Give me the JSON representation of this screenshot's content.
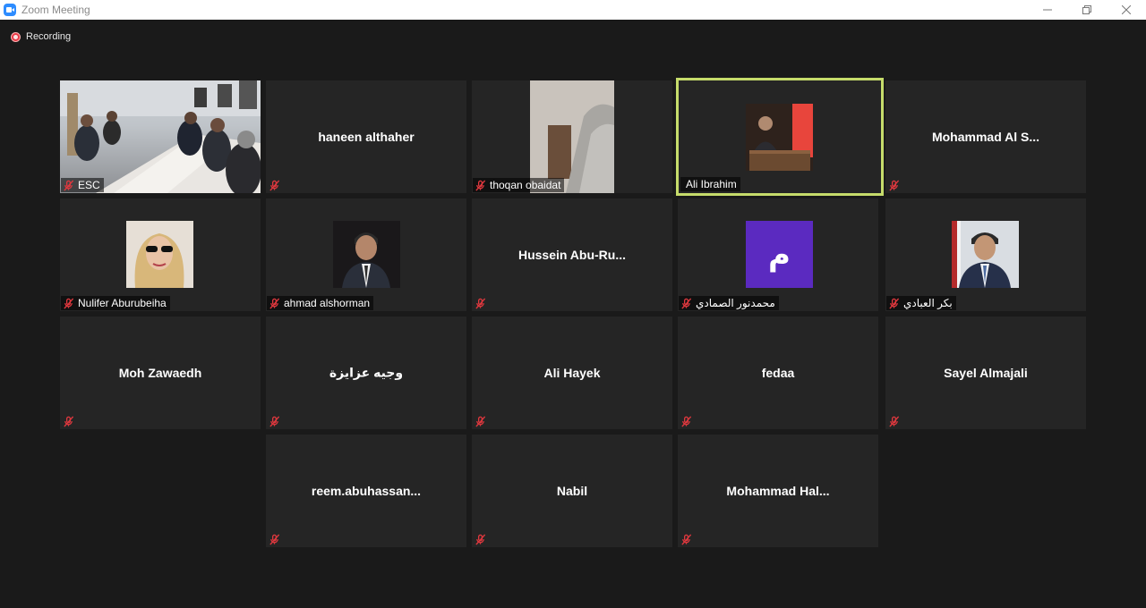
{
  "window": {
    "title": "Zoom Meeting",
    "icon": "zoom-app-icon"
  },
  "recording": {
    "label": "Recording"
  },
  "colors": {
    "active_speaker_border": "#c6dc6b",
    "tile_bg": "#252525",
    "mic_off": "#e0383e",
    "avatar_purple": "#5b2ac0"
  },
  "participants": [
    {
      "name": "ESC",
      "video": true,
      "muted": true
    },
    {
      "name": "haneen althaher",
      "video": false,
      "muted": true
    },
    {
      "name": "thoqan obaidat",
      "video": true,
      "muted": true
    },
    {
      "name": "Ali Ibrahim",
      "video": true,
      "muted": false,
      "speaking": true
    },
    {
      "name": "Mohammad  Al  S...",
      "video": false,
      "muted": true
    },
    {
      "name": "Nulifer Aburubeiha",
      "video": true,
      "muted": true
    },
    {
      "name": "ahmad alshorman",
      "video": true,
      "muted": true
    },
    {
      "name": "Hussein   Abu-Ru...",
      "video": false,
      "muted": true
    },
    {
      "name": "محمدنور الصمادي",
      "video": true,
      "avatar_letter": "م",
      "muted": true
    },
    {
      "name": "بكر العبادي",
      "video": true,
      "muted": true
    },
    {
      "name": "Moh Zawaedh",
      "video": false,
      "muted": true
    },
    {
      "name": "وجيه عزايزة",
      "video": false,
      "muted": true
    },
    {
      "name": "Ali Hayek",
      "video": false,
      "muted": true
    },
    {
      "name": "fedaa",
      "video": false,
      "muted": true
    },
    {
      "name": "Sayel Almajali",
      "video": false,
      "muted": true
    },
    {
      "name": "reem.abuhassan...",
      "video": false,
      "muted": true
    },
    {
      "name": "Nabil",
      "video": false,
      "muted": true
    },
    {
      "name": "Mohammad  Hal...",
      "video": false,
      "muted": true
    }
  ]
}
